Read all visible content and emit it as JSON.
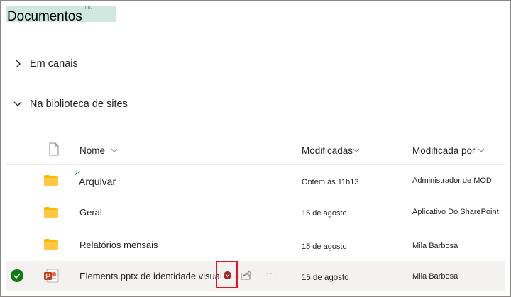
{
  "page": {
    "title": "Documentos",
    "title_hint": "00-"
  },
  "sections": [
    {
      "label": "Em canais",
      "expanded": false
    },
    {
      "label": "Na biblioteca de sites",
      "expanded": true
    }
  ],
  "columns": {
    "name": "Nome",
    "modified": "Modificadas",
    "modified_by": "Modificada por"
  },
  "rows": [
    {
      "name": "Arquivar",
      "modified": "Ontem às 11h13",
      "modified_by": "Administrador de MOD",
      "type": "folder",
      "selected": false
    },
    {
      "name": "Geral",
      "modified": "15 de agosto",
      "modified_by": "Aplicativo Do SharePoint",
      "type": "folder",
      "selected": false
    },
    {
      "name": "Relatórios mensais",
      "modified": "15 de agosto",
      "modified_by": "Mila Barbosa",
      "type": "folder",
      "selected": false
    },
    {
      "name": "Elements.pptx de identidade visual",
      "modified": "15 de agosto",
      "modified_by": "Mila Barbosa",
      "type": "pptx",
      "selected": true
    }
  ],
  "colors": {
    "folder": "#ffb900",
    "selected_check": "#107c10",
    "highlight": "#e81123",
    "powerpoint": "#c43e1c",
    "title_highlight": "#cfe8e0"
  },
  "icons": {
    "section_collapsed": "chevron-right-icon",
    "section_expanded": "chevron-down-icon",
    "file_type_header": "document-icon",
    "sort": "chevron-down-icon",
    "folder": "folder-icon",
    "pptx": "powerpoint-icon",
    "check": "checkmark-icon",
    "share": "share-icon",
    "more": "more-icon"
  }
}
